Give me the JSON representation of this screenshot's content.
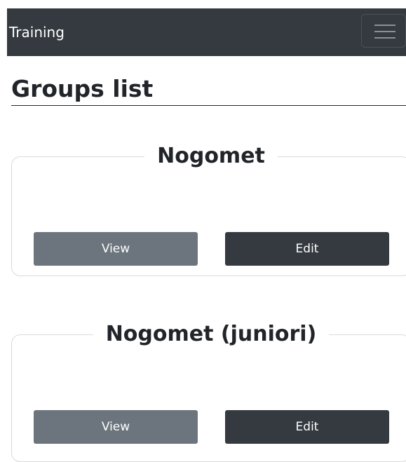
{
  "navbar": {
    "brand": "Training",
    "toggler_icon": "hamburger-menu-icon"
  },
  "page": {
    "title": "Groups list"
  },
  "groups": [
    {
      "name": "Nogomet",
      "view_label": "View",
      "edit_label": "Edit"
    },
    {
      "name": "Nogomet (juniori)",
      "view_label": "View",
      "edit_label": "Edit"
    }
  ],
  "colors": {
    "navbar_bg": "#343a40",
    "view_button": "#6c757d",
    "edit_button": "#343a40"
  }
}
